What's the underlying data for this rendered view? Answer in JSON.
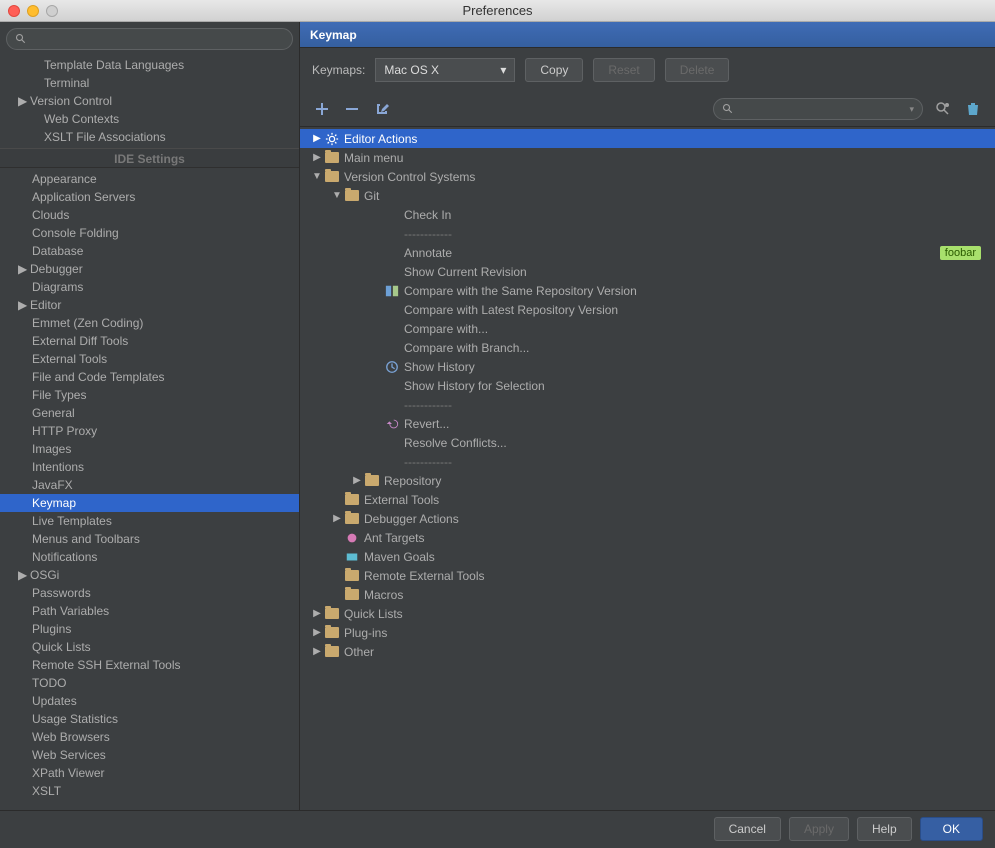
{
  "window": {
    "title": "Preferences"
  },
  "sidebar": {
    "search_placeholder": "",
    "items": [
      {
        "label": "Template Data Languages",
        "indent": true,
        "arrow": false
      },
      {
        "label": "Terminal",
        "indent": true,
        "arrow": false
      },
      {
        "label": "Version Control",
        "indent": false,
        "arrow": true
      },
      {
        "label": "Web Contexts",
        "indent": true,
        "arrow": false
      },
      {
        "label": "XSLT File Associations",
        "indent": true,
        "arrow": false
      }
    ],
    "section_header": "IDE Settings",
    "ide_items": [
      {
        "label": "Appearance",
        "arrow": false
      },
      {
        "label": "Application Servers",
        "arrow": false
      },
      {
        "label": "Clouds",
        "arrow": false
      },
      {
        "label": "Console Folding",
        "arrow": false
      },
      {
        "label": "Database",
        "arrow": false
      },
      {
        "label": "Debugger",
        "arrow": true
      },
      {
        "label": "Diagrams",
        "arrow": false
      },
      {
        "label": "Editor",
        "arrow": true
      },
      {
        "label": "Emmet (Zen Coding)",
        "arrow": false
      },
      {
        "label": "External Diff Tools",
        "arrow": false
      },
      {
        "label": "External Tools",
        "arrow": false
      },
      {
        "label": "File and Code Templates",
        "arrow": false
      },
      {
        "label": "File Types",
        "arrow": false
      },
      {
        "label": "General",
        "arrow": false
      },
      {
        "label": "HTTP Proxy",
        "arrow": false
      },
      {
        "label": "Images",
        "arrow": false
      },
      {
        "label": "Intentions",
        "arrow": false
      },
      {
        "label": "JavaFX",
        "arrow": false
      },
      {
        "label": "Keymap",
        "arrow": false,
        "selected": true
      },
      {
        "label": "Live Templates",
        "arrow": false
      },
      {
        "label": "Menus and Toolbars",
        "arrow": false
      },
      {
        "label": "Notifications",
        "arrow": false
      },
      {
        "label": "OSGi",
        "arrow": true
      },
      {
        "label": "Passwords",
        "arrow": false
      },
      {
        "label": "Path Variables",
        "arrow": false
      },
      {
        "label": "Plugins",
        "arrow": false
      },
      {
        "label": "Quick Lists",
        "arrow": false
      },
      {
        "label": "Remote SSH External Tools",
        "arrow": false
      },
      {
        "label": "TODO",
        "arrow": false
      },
      {
        "label": "Updates",
        "arrow": false
      },
      {
        "label": "Usage Statistics",
        "arrow": false
      },
      {
        "label": "Web Browsers",
        "arrow": false
      },
      {
        "label": "Web Services",
        "arrow": false
      },
      {
        "label": "XPath Viewer",
        "arrow": false
      },
      {
        "label": "XSLT",
        "arrow": false
      }
    ]
  },
  "main": {
    "title": "Keymap",
    "keymaps_label": "Keymaps:",
    "keymaps_value": "Mac OS X",
    "copy_btn": "Copy",
    "reset_btn": "Reset",
    "delete_btn": "Delete",
    "tree": [
      {
        "level": 0,
        "arrow": "▶",
        "icon": "gear",
        "label": "Editor Actions",
        "selected": true
      },
      {
        "level": 0,
        "arrow": "▶",
        "icon": "folder",
        "label": "Main menu"
      },
      {
        "level": 0,
        "arrow": "▼",
        "icon": "folder",
        "label": "Version Control Systems"
      },
      {
        "level": 1,
        "arrow": "▼",
        "icon": "folder",
        "label": "Git"
      },
      {
        "level": 3,
        "arrow": "",
        "icon": "",
        "label": "Check In"
      },
      {
        "level": 3,
        "arrow": "",
        "icon": "",
        "label": "------------",
        "sep": true
      },
      {
        "level": 3,
        "arrow": "",
        "icon": "",
        "label": "Annotate",
        "badge": "foobar"
      },
      {
        "level": 3,
        "arrow": "",
        "icon": "",
        "label": "Show Current Revision"
      },
      {
        "level": 3,
        "arrow": "",
        "icon": "compare",
        "label": "Compare with the Same Repository Version"
      },
      {
        "level": 3,
        "arrow": "",
        "icon": "",
        "label": "Compare with Latest Repository Version"
      },
      {
        "level": 3,
        "arrow": "",
        "icon": "",
        "label": "Compare with..."
      },
      {
        "level": 3,
        "arrow": "",
        "icon": "",
        "label": "Compare with Branch..."
      },
      {
        "level": 3,
        "arrow": "",
        "icon": "history",
        "label": "Show History"
      },
      {
        "level": 3,
        "arrow": "",
        "icon": "",
        "label": "Show History for Selection"
      },
      {
        "level": 3,
        "arrow": "",
        "icon": "",
        "label": "------------",
        "sep": true
      },
      {
        "level": 3,
        "arrow": "",
        "icon": "revert",
        "label": "Revert..."
      },
      {
        "level": 3,
        "arrow": "",
        "icon": "",
        "label": "Resolve Conflicts..."
      },
      {
        "level": 3,
        "arrow": "",
        "icon": "",
        "label": "------------",
        "sep": true
      },
      {
        "level": 2,
        "arrow": "▶",
        "icon": "folder",
        "label": "Repository"
      },
      {
        "level": 1,
        "arrow": "",
        "icon": "folder-ext",
        "label": "External Tools"
      },
      {
        "level": 1,
        "arrow": "▶",
        "icon": "folder",
        "label": "Debugger Actions"
      },
      {
        "level": 1,
        "arrow": "",
        "icon": "ant",
        "label": "Ant Targets"
      },
      {
        "level": 1,
        "arrow": "",
        "icon": "maven",
        "label": "Maven Goals"
      },
      {
        "level": 1,
        "arrow": "",
        "icon": "folder-ext",
        "label": "Remote External Tools"
      },
      {
        "level": 1,
        "arrow": "",
        "icon": "folder",
        "label": "Macros"
      },
      {
        "level": 0,
        "arrow": "▶",
        "icon": "folder",
        "label": "Quick Lists"
      },
      {
        "level": 0,
        "arrow": "▶",
        "icon": "folder-plug",
        "label": "Plug-ins"
      },
      {
        "level": 0,
        "arrow": "▶",
        "icon": "folder-other",
        "label": "Other"
      }
    ]
  },
  "footer": {
    "cancel": "Cancel",
    "apply": "Apply",
    "help": "Help",
    "ok": "OK"
  }
}
